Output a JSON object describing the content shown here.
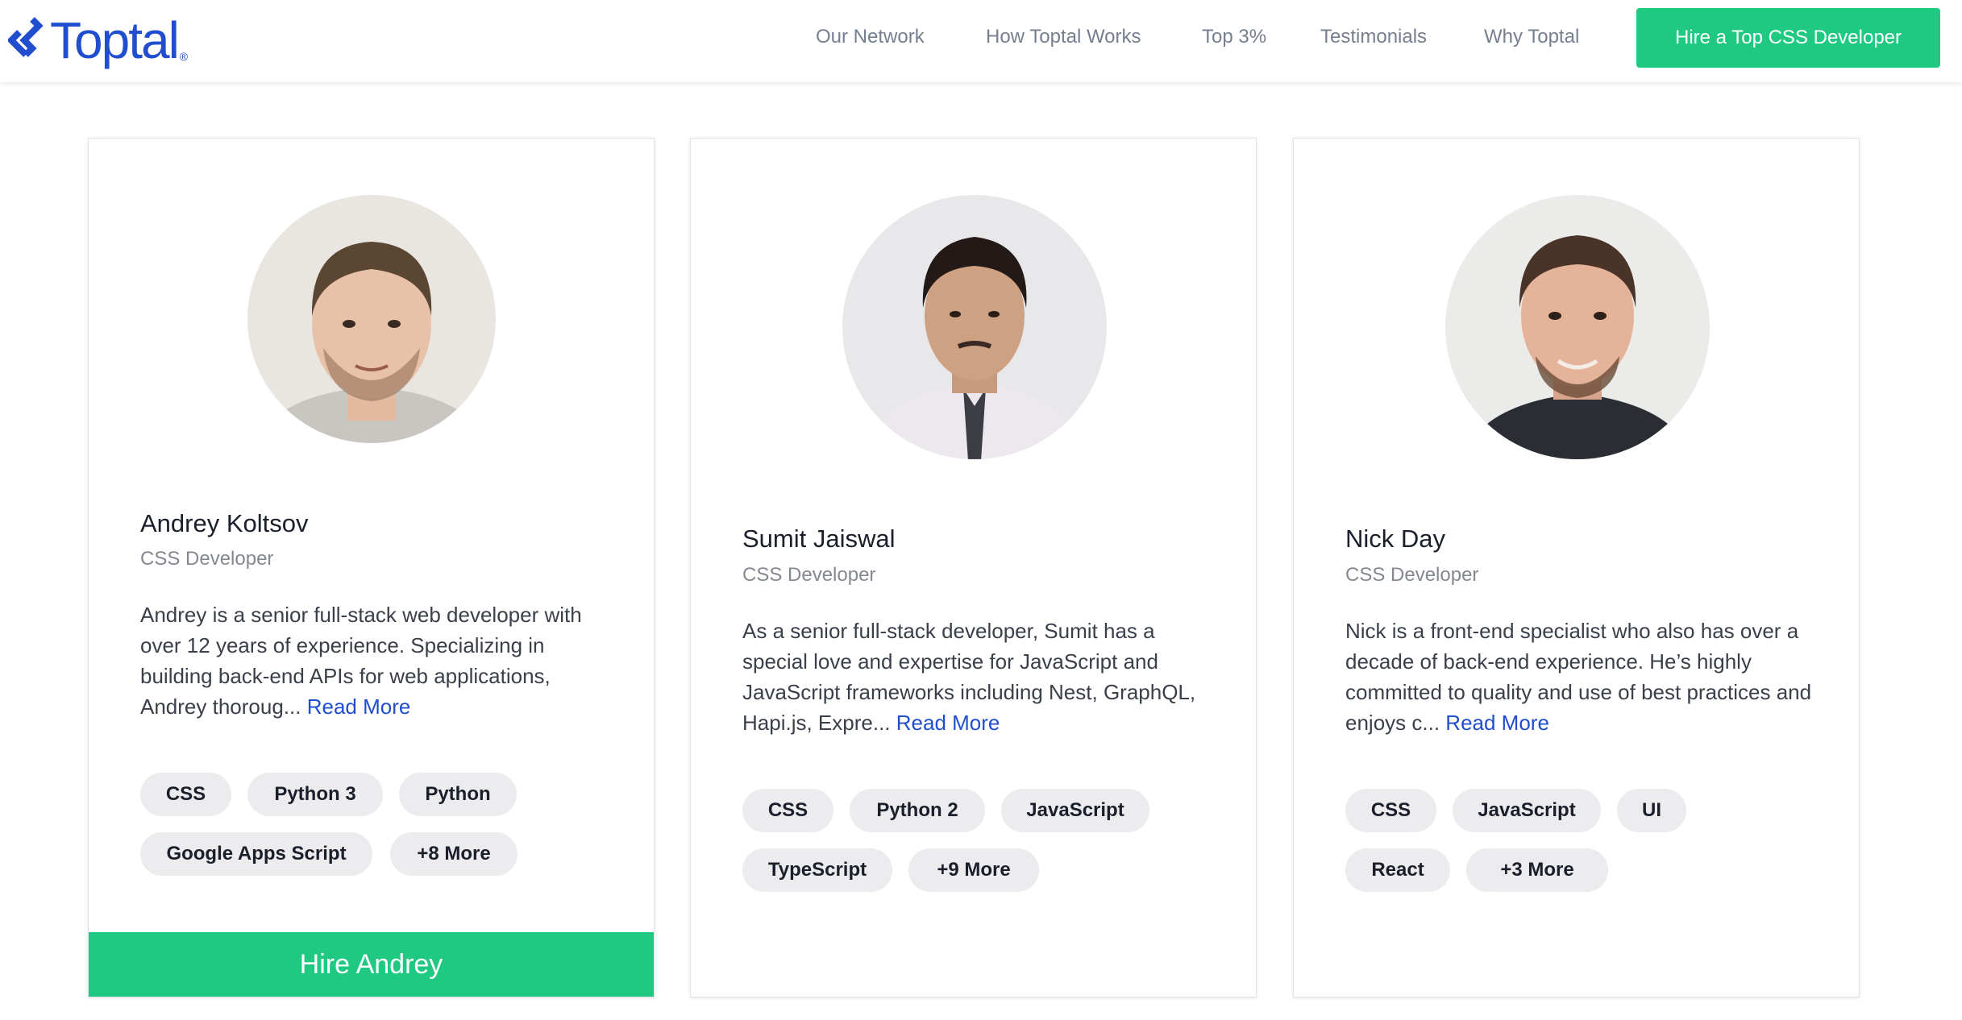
{
  "header": {
    "logo_text": "Toptal",
    "logo_mark": "®",
    "nav": [
      "Our Network",
      "How Toptal Works",
      "Top 3%",
      "Testimonials",
      "Why Toptal"
    ],
    "cta_label": "Hire a Top CSS Developer"
  },
  "colors": {
    "brand_blue": "#204ecf",
    "brand_green": "#20c982"
  },
  "cards": [
    {
      "name": "Andrey Koltsov",
      "role": "CSS Developer",
      "bio": "Andrey is a senior full-stack web developer with over 12 years of experience. Specializing in building back-end APIs for web applications, Andrey thoroug...",
      "read_more": "Read More",
      "skills": [
        "CSS",
        "Python 3",
        "Python",
        "Google Apps Script",
        "+8 More"
      ],
      "hire_label": "Hire Andrey"
    },
    {
      "name": "Sumit Jaiswal",
      "role": "CSS Developer",
      "bio": "As a senior full-stack developer, Sumit has a special love and expertise for JavaScript and JavaScript frameworks including Nest, GraphQL, Hapi.js, Expre...",
      "read_more": "Read More",
      "skills": [
        "CSS",
        "Python 2",
        "JavaScript",
        "TypeScript",
        "+9 More"
      ]
    },
    {
      "name": "Nick Day",
      "role": "CSS Developer",
      "bio": "Nick is a front-end specialist who also has over a decade of back-end experience. He’s highly committed to quality and use of best practices and enjoys c...",
      "read_more": "Read More",
      "skills": [
        "CSS",
        "JavaScript",
        "UI",
        "React",
        "+3 More"
      ]
    }
  ]
}
